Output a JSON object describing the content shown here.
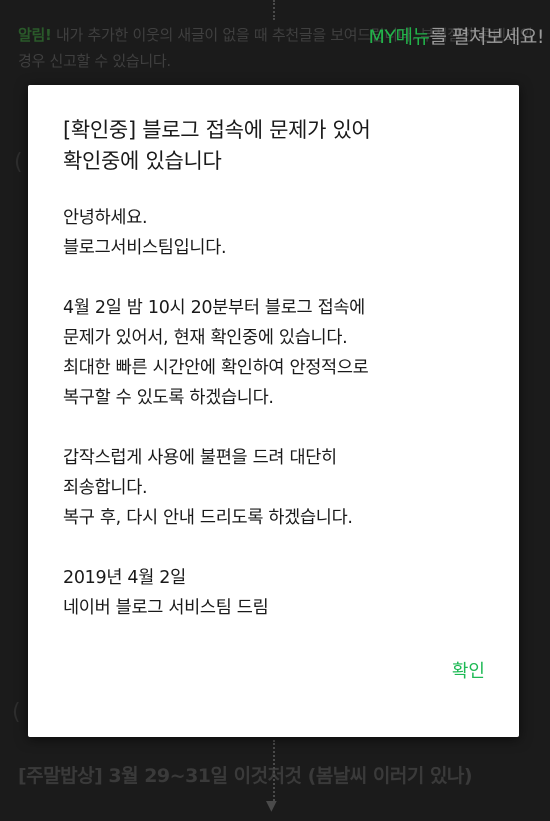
{
  "background": {
    "notice_tag": "알림!",
    "notice_text": "내가 추가한 이웃의 새글이 없을 때 추천글을 보여드립니다. 부적절한 콘텐츠의 경우 신고할 수 있습니다.",
    "tooltip_highlight": "MY메뉴",
    "tooltip_rest": "를 펼쳐보세요!",
    "post_title": "[주말밥상] 3월 29~31일 이것저것 (봄날씨 이러기 있나)"
  },
  "dialog": {
    "title_line1": "[확인중] 블로그 접속에 문제가 있어",
    "title_line2": "확인중에 있습니다",
    "greeting_line1": "안녕하세요.",
    "greeting_line2": "블로그서비스팀입니다.",
    "issue_line1": "4월 2일 밤 10시 20분부터 블로그 접속에",
    "issue_line2": "문제가 있어서, 현재 확인중에 있습니다.",
    "issue_line3": "최대한 빠른 시간안에 확인하여 안정적으로",
    "issue_line4": "복구할 수 있도록 하겠습니다.",
    "apology_line1": "갑작스럽게 사용에 불편을 드려 대단히",
    "apology_line2": "죄송합니다.",
    "apology_line3": "복구 후, 다시 안내 드리도록 하겠습니다.",
    "date": "2019년 4월 2일",
    "signature": "네이버 블로그 서비스팀 드림",
    "confirm_label": "확인"
  },
  "colors": {
    "accent_green": "#1db954",
    "overlay_dark": "#1b1b1b",
    "dialog_bg": "#ffffff"
  }
}
